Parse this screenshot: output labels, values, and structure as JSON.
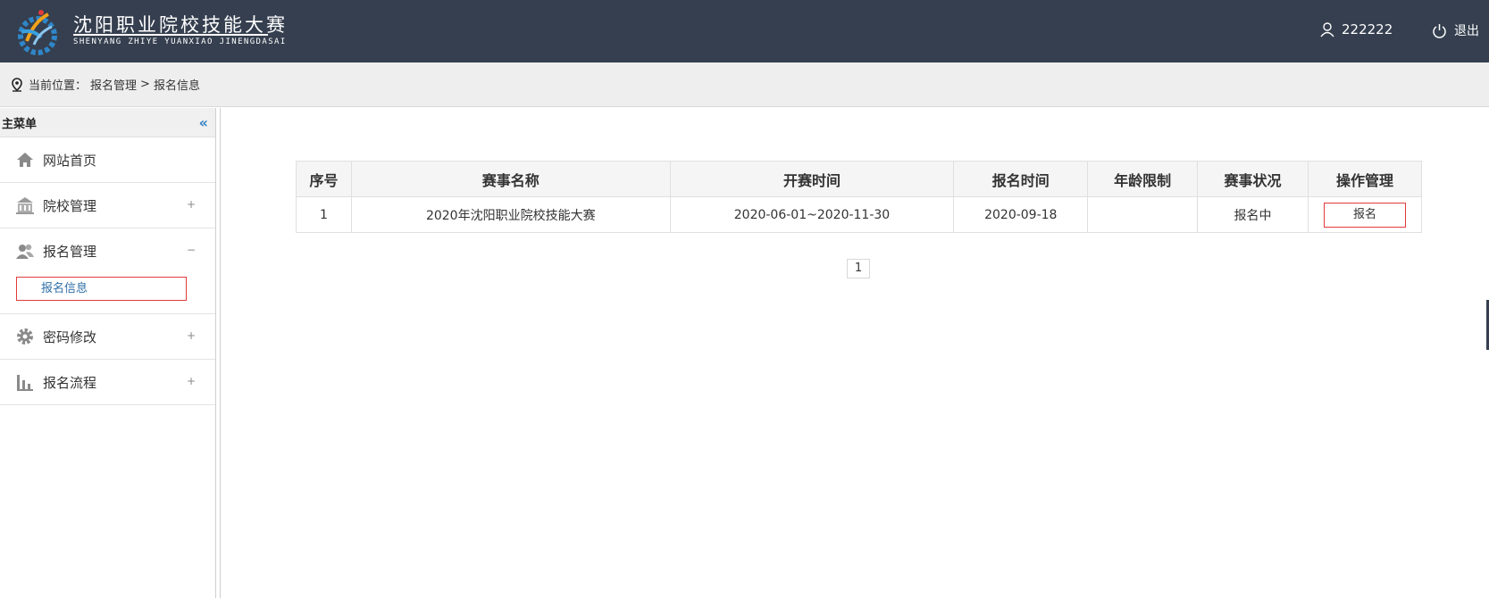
{
  "header": {
    "brand_cn": "沈阳职业院校技能大赛",
    "brand_en": "SHENYANG ZHIYE YUANXIAO JINENGDASAI",
    "username": "222222",
    "logout_label": "退出",
    "bg_color": "#353f4f"
  },
  "breadcrumb": {
    "prefix": "当前位置：",
    "level1": "报名管理",
    "separator": ">",
    "level2": "报名信息"
  },
  "sidebar": {
    "title": "主菜单",
    "collapse_glyph": "«",
    "items": [
      {
        "label": "网站首页",
        "icon": "home-icon",
        "sign": ""
      },
      {
        "label": "院校管理",
        "icon": "school-icon",
        "sign": "+"
      },
      {
        "label": "报名管理",
        "icon": "users-icon",
        "sign": "−"
      },
      {
        "label": "密码修改",
        "icon": "gear-icon",
        "sign": "+"
      },
      {
        "label": "报名流程",
        "icon": "bar-chart-icon",
        "sign": "+"
      }
    ],
    "submenu_active": "报名信息"
  },
  "table": {
    "headers": [
      "序号",
      "赛事名称",
      "开赛时间",
      "报名时间",
      "年龄限制",
      "赛事状况",
      "操作管理"
    ],
    "rows": [
      {
        "index": "1",
        "name": "2020年沈阳职业院校技能大赛",
        "period": "2020-06-01~2020-11-30",
        "signup_date": "2020-09-18",
        "age_limit": "",
        "status": "报名中",
        "action": "报名"
      }
    ]
  },
  "pagination": {
    "current_page": "1"
  }
}
